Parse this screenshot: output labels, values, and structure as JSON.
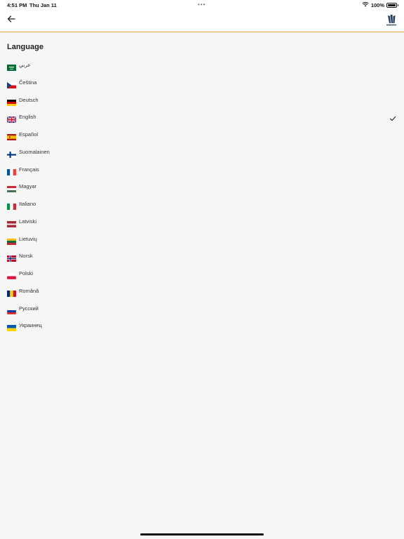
{
  "status_bar": {
    "time": "4:51 PM",
    "date": "Thu Jan 11",
    "dots": "•••",
    "battery_percent": "100%",
    "wifi_icon": "wifi-icon",
    "battery_icon": "battery-icon"
  },
  "nav": {
    "back_icon": "arrow-left-icon",
    "logo_icon": "app-logo-icon"
  },
  "page_title": "Language",
  "accent_color": "#e8a04a",
  "selected_language": "English",
  "languages": [
    {
      "label": "عربي",
      "flag": "saudi-arabia-flag-icon"
    },
    {
      "label": "Čeština",
      "flag": "czech-flag-icon"
    },
    {
      "label": "Deutsch",
      "flag": "germany-flag-icon"
    },
    {
      "label": "English",
      "flag": "uk-flag-icon"
    },
    {
      "label": "Español",
      "flag": "spain-flag-icon"
    },
    {
      "label": "Suomalainen",
      "flag": "finland-flag-icon"
    },
    {
      "label": "Français",
      "flag": "france-flag-icon"
    },
    {
      "label": "Magyar",
      "flag": "hungary-flag-icon"
    },
    {
      "label": "Italiano",
      "flag": "italy-flag-icon"
    },
    {
      "label": "Latviski",
      "flag": "latvia-flag-icon"
    },
    {
      "label": "Lietuvių",
      "flag": "lithuania-flag-icon"
    },
    {
      "label": "Norsk",
      "flag": "norway-flag-icon"
    },
    {
      "label": "Polski",
      "flag": "poland-flag-icon"
    },
    {
      "label": "Română",
      "flag": "romania-flag-icon"
    },
    {
      "label": "Русский",
      "flag": "russia-flag-icon"
    },
    {
      "label": "Украинец",
      "flag": "ukraine-flag-icon"
    }
  ]
}
